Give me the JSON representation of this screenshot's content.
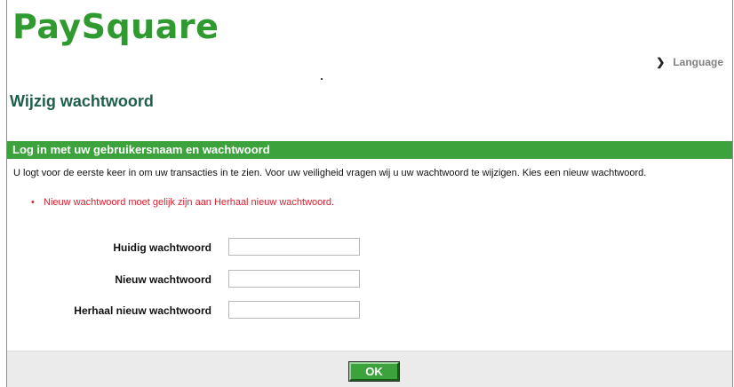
{
  "header": {
    "logo_text": "PaySquare",
    "language_label": "Language"
  },
  "page": {
    "title": "Wijzig wachtwoord",
    "section_title": "Log in met uw gebruikersnaam en wachtwoord",
    "intro": "U logt voor de eerste keer in om uw transacties in te zien. Voor uw veiligheid vragen wij u uw wachtwoord te wijzigen. Kies een nieuw wachtwoord.",
    "error_message": "Nieuw wachtwoord moet gelijk zijn aan Herhaal nieuw wachtwoord."
  },
  "form": {
    "current_password_label": "Huidig wachtwoord",
    "current_password_value": "",
    "new_password_label": "Nieuw wachtwoord",
    "new_password_value": "",
    "repeat_password_label": "Herhaal nieuw wachtwoord",
    "repeat_password_value": ""
  },
  "actions": {
    "ok_label": "OK"
  },
  "colors": {
    "brand_green": "#3ca23c",
    "title_green": "#1e5e4d",
    "error_red": "#d9202f"
  },
  "icons": {
    "language": "chevron-right-icon",
    "error_bullet": "bullet-icon"
  }
}
